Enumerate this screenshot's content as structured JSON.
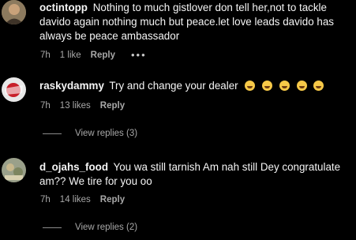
{
  "comments": [
    {
      "username": "octintopp",
      "text": "Nothing to much gistlover don tell her,not to tackle davido again nothing much but peace.let love leads davido has always be peace ambassador",
      "time": "7h",
      "likes": "1 like",
      "reply_label": "Reply",
      "more_label": "•••"
    },
    {
      "username": "raskydammy",
      "text": "Try and change your dealer",
      "emojis": [
        "face-with-tears-of-joy",
        "face-with-tears-of-joy",
        "face-with-tears-of-joy",
        "face-with-tears-of-joy",
        "face-with-tears-of-joy"
      ],
      "time": "7h",
      "likes": "13 likes",
      "reply_label": "Reply",
      "view_replies": "View replies (3)"
    },
    {
      "username": "d_ojahs_food",
      "text": "You wa still tarnish Am nah still Dey congratulate am?? We tire for you oo",
      "time": "7h",
      "likes": "14 likes",
      "reply_label": "Reply",
      "view_replies": "View replies (2)"
    }
  ],
  "colors": {
    "background": "#000000",
    "text": "#f5f5f5",
    "muted": "#a8a8a8",
    "emoji": "#f7c948"
  }
}
